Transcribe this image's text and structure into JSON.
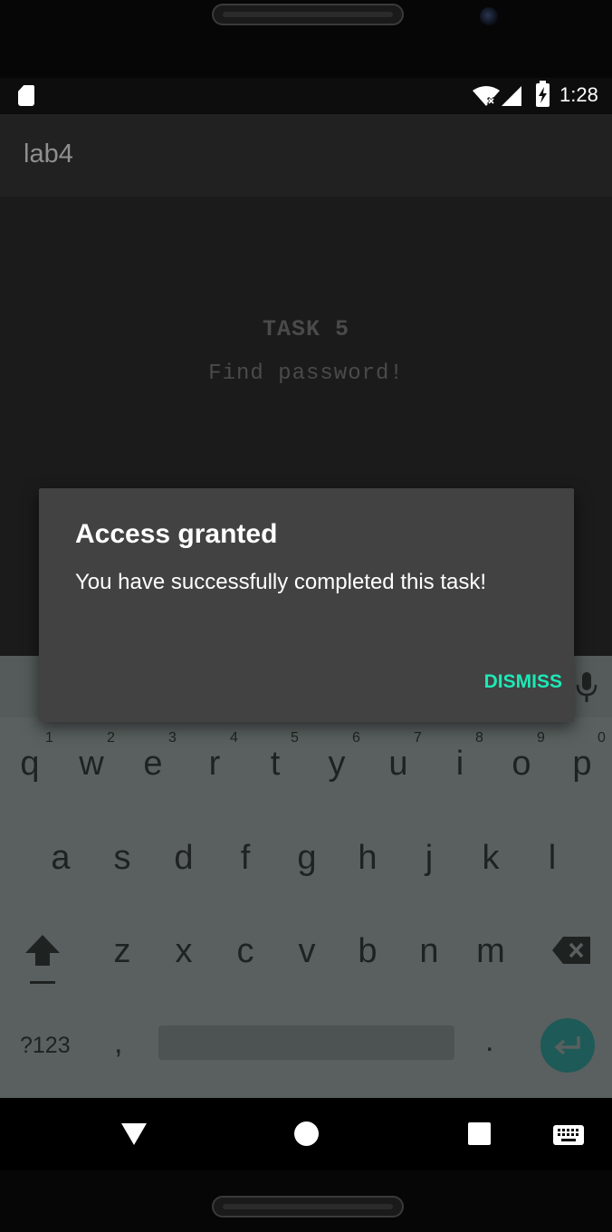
{
  "status_bar": {
    "time": "1:28",
    "icons": [
      "sd-card-icon",
      "wifi-icon",
      "signal-icon",
      "battery-charging-icon"
    ]
  },
  "app_bar": {
    "title": "lab4"
  },
  "content": {
    "task_title": "TASK 5",
    "task_subtitle": "Find password!"
  },
  "dialog": {
    "title": "Access granted",
    "message": "You have successfully completed this task!",
    "dismiss_label": "DISMISS",
    "accent_color": "#1de9b6"
  },
  "keyboard": {
    "row1": [
      {
        "key": "q",
        "hint": "1"
      },
      {
        "key": "w",
        "hint": "2"
      },
      {
        "key": "e",
        "hint": "3"
      },
      {
        "key": "r",
        "hint": "4"
      },
      {
        "key": "t",
        "hint": "5"
      },
      {
        "key": "y",
        "hint": "6"
      },
      {
        "key": "u",
        "hint": "7"
      },
      {
        "key": "i",
        "hint": "8"
      },
      {
        "key": "o",
        "hint": "9"
      },
      {
        "key": "p",
        "hint": "0"
      }
    ],
    "row2": [
      "a",
      "s",
      "d",
      "f",
      "g",
      "h",
      "j",
      "k",
      "l"
    ],
    "row3": [
      "z",
      "x",
      "c",
      "v",
      "b",
      "n",
      "m"
    ],
    "symbols_label": "?123",
    "comma_label": ",",
    "period_label": "."
  },
  "nav_bar": {
    "icons": [
      "back-icon",
      "home-icon",
      "recents-icon",
      "keyboard-switch-icon"
    ]
  }
}
